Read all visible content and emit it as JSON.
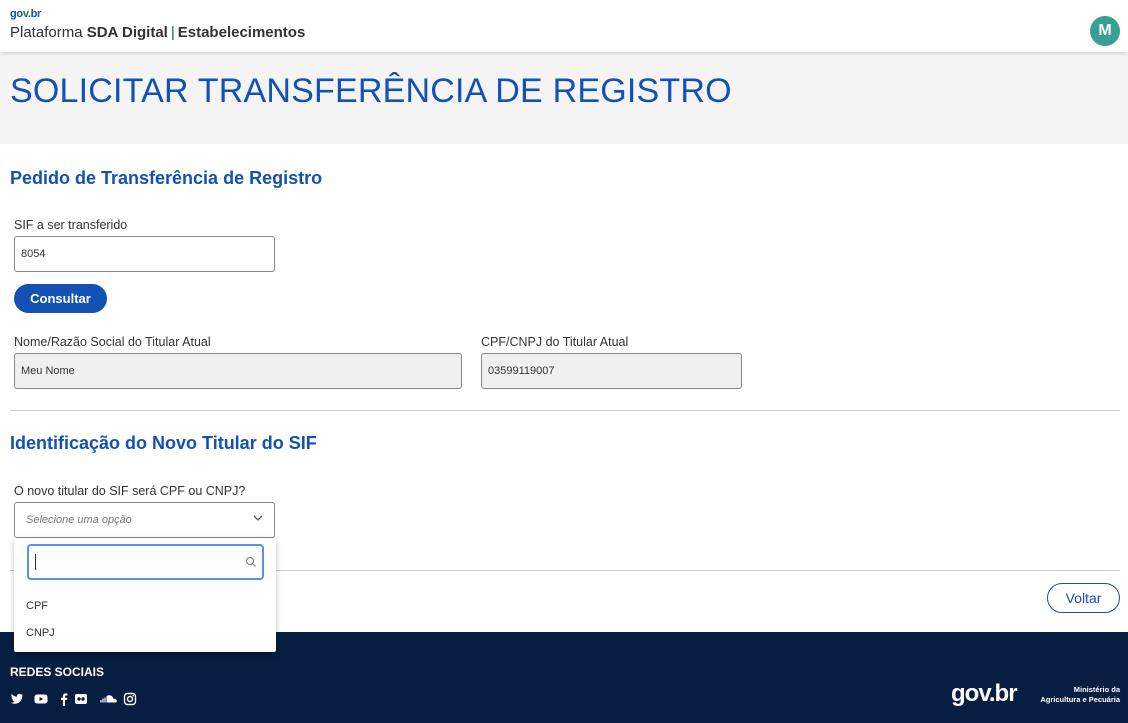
{
  "header": {
    "logo_g": "go",
    "logo_v": "v",
    "logo_b": ".br",
    "platform_prefix": "Plataforma",
    "platform_name": "SDA Digital",
    "separator": "|",
    "platform_module": "Estabelecimentos",
    "avatar_initial": "M"
  },
  "page": {
    "title": "SOLICITAR TRANSFERÊNCIA DE REGISTRO"
  },
  "section_request": {
    "title": "Pedido de Transferência de Registro",
    "sif_label": "SIF a ser transferido",
    "sif_value": "8054",
    "consult_button": "Consultar",
    "name_label": "Nome/Razão Social do Titular Atual",
    "name_value": "Meu Nome",
    "doc_label": "CPF/CNPJ do Titular Atual",
    "doc_value": "03599119007"
  },
  "section_new_holder": {
    "title": "Identificação do Novo Titular do SIF",
    "question_label": "O novo titular do SIF será CPF ou CNPJ?",
    "select_placeholder": "Selecione uma opção",
    "search_value": "",
    "options": [
      "CPF",
      "CNPJ"
    ]
  },
  "actions": {
    "back_button": "Voltar"
  },
  "footer": {
    "social_title": "REDES SOCIAIS",
    "social_icons": [
      "twitter-icon",
      "youtube-icon",
      "facebook-icon",
      "flickr-icon",
      "soundcloud-icon",
      "instagram-icon"
    ],
    "gov_logo": "gov.br",
    "ministry_line1": "Ministério da",
    "ministry_line2": "Agricultura e Pecuária"
  },
  "colors": {
    "primary": "#1351b4",
    "footer_bg": "#071d41",
    "avatar_bg": "#36a191",
    "banner_bg": "#f4f4f4"
  }
}
